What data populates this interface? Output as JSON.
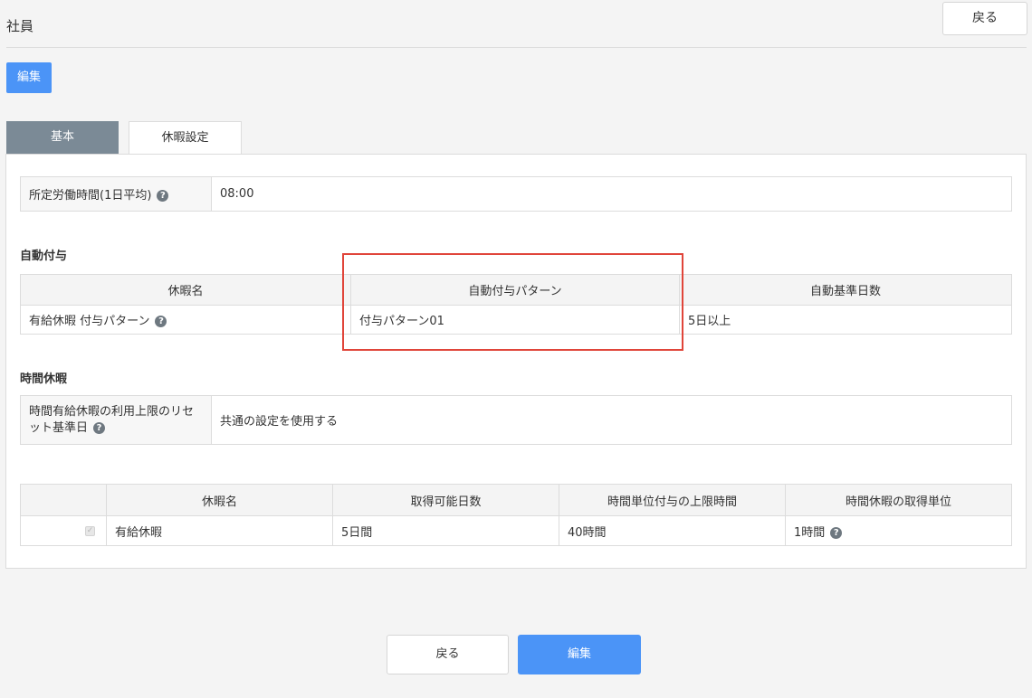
{
  "page": {
    "title": "社員",
    "back_label": "戻る"
  },
  "toolbar": {
    "edit_label": "編集"
  },
  "tabs": [
    {
      "label": "基本",
      "active": false
    },
    {
      "label": "休暇設定",
      "active": true
    }
  ],
  "work_hours": {
    "label": "所定労働時間(1日平均)",
    "value": "08:00"
  },
  "auto_grant": {
    "title": "自動付与",
    "headers": [
      "休暇名",
      "自動付与パターン",
      "自動基準日数"
    ],
    "row": {
      "name": "有給休暇 付与パターン",
      "pattern": "付与パターン01",
      "days": "5日以上"
    }
  },
  "hourly_leave": {
    "title": "時間休暇",
    "label": "時間有給休暇の利用上限のリセット基準日",
    "value": "共通の設定を使用する"
  },
  "leave_table": {
    "headers": [
      "休暇名",
      "取得可能日数",
      "時間単位付与の上限時間",
      "時間休暇の取得単位"
    ],
    "rows": [
      {
        "checked": true,
        "name": "有給休暇",
        "days": "5日間",
        "max_hours": "40時間",
        "unit": "1時間"
      }
    ]
  },
  "footer": {
    "back_label": "戻る",
    "edit_label": "編集"
  },
  "icons": {
    "help": "question-circle-icon",
    "checkbox": "checkbox-icon"
  },
  "colors": {
    "primary": "#4b94f7",
    "tab_inactive": "#7b8a96",
    "highlight": "#e0453a"
  }
}
